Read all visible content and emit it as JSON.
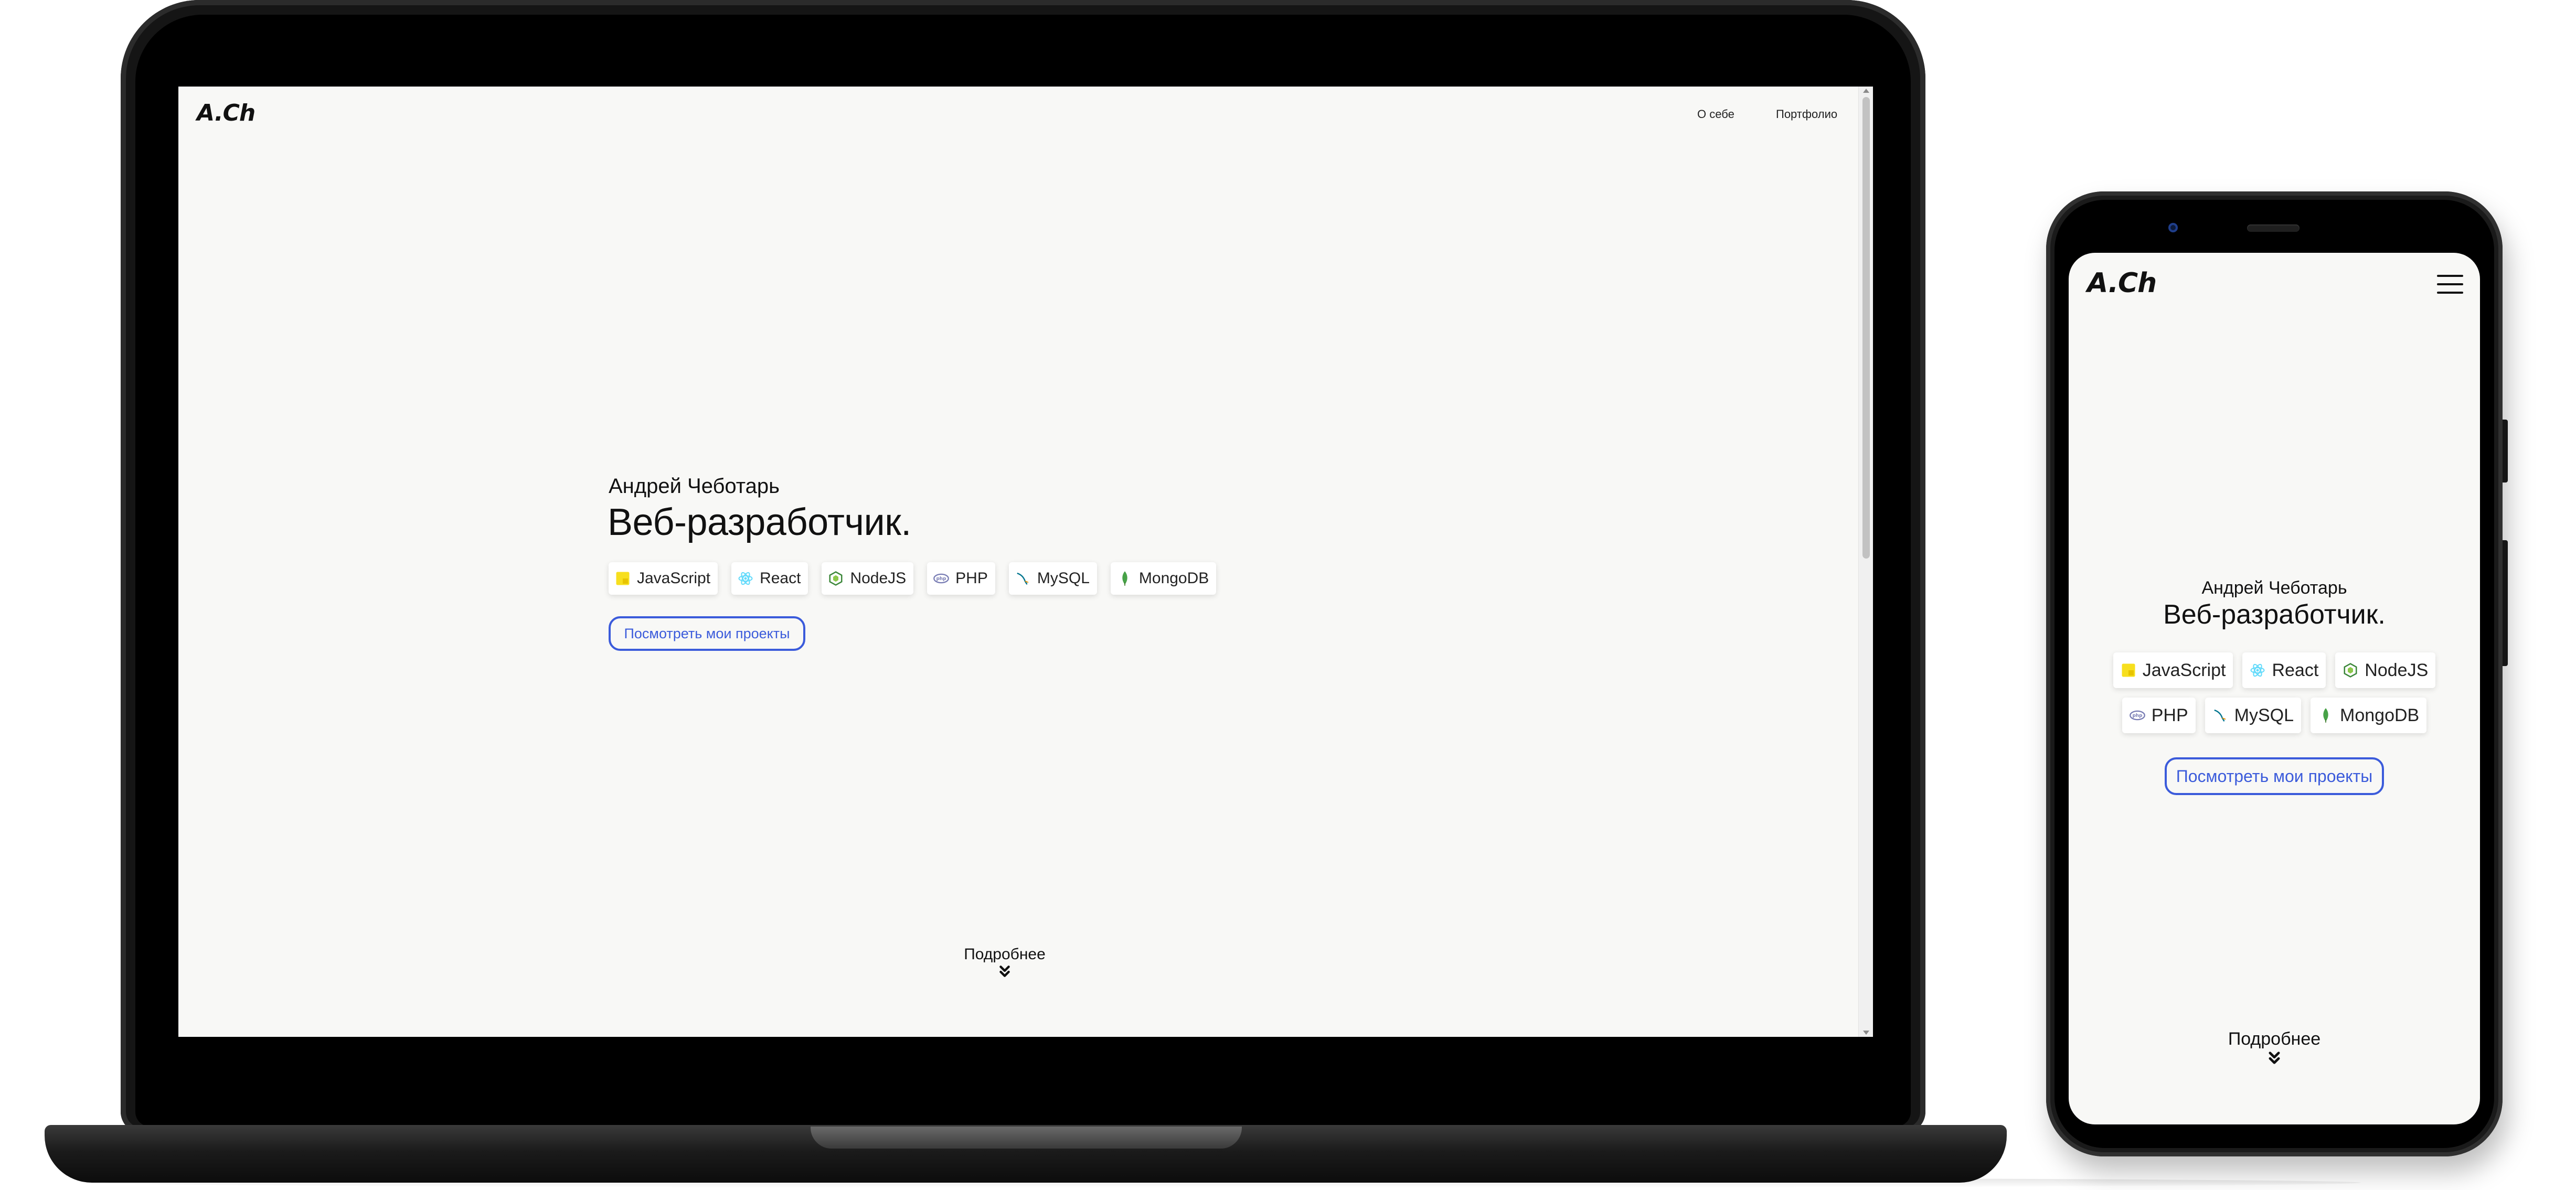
{
  "brand": "A.Ch",
  "nav": {
    "about": "О себе",
    "portfolio": "Портфолио"
  },
  "hero": {
    "greeting": "Андрей Чеботарь",
    "title": "Веб-разработчик.",
    "technologies": [
      "JavaScript",
      "React",
      "NodeJS",
      "PHP",
      "MySQL",
      "MongoDB"
    ],
    "cta_label": "Посмотреть мои проекты"
  },
  "more_label": "Подробнее",
  "icons": [
    "javascript-icon",
    "react-icon",
    "nodejs-icon",
    "php-icon",
    "mysql-icon",
    "mongodb-icon",
    "chevron-double-down-icon",
    "hamburger-menu-icon"
  ],
  "colors": {
    "accent": "#3b5bdb",
    "page_bg": "#f8f8f6",
    "text": "#111111",
    "javascript": "#f7df1e",
    "react": "#61dafb",
    "nodejs": "#3c873a",
    "php": "#777bb3",
    "mysql": "#00758f",
    "mongodb": "#47a248"
  }
}
